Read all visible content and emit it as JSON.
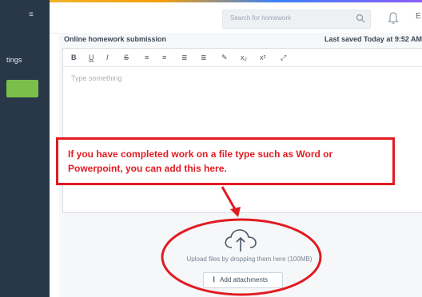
{
  "sidebar": {
    "menu_icon": "hamburger-icon",
    "label": "tings"
  },
  "header": {
    "search_placeholder": "Search for homework",
    "search_icon": "search-icon",
    "bell_icon": "bell-icon",
    "user_initial": "E"
  },
  "editor": {
    "title": "Online homework submission",
    "last_saved": "Last saved Today at 9:52 AM",
    "placeholder": "Type something",
    "toolbar": [
      {
        "name": "bold",
        "label": "B"
      },
      {
        "name": "underline",
        "label": "U"
      },
      {
        "name": "italic",
        "label": "I"
      },
      {
        "name": "strikethrough",
        "label": "S"
      },
      {
        "name": "bullet-list",
        "label": "≡"
      },
      {
        "name": "numbered-list",
        "label": "≡"
      },
      {
        "name": "align-left",
        "label": "≣"
      },
      {
        "name": "align-right",
        "label": "≣"
      },
      {
        "name": "link",
        "label": "✎"
      },
      {
        "name": "subscript",
        "label": "x₂"
      },
      {
        "name": "superscript",
        "label": "x²"
      },
      {
        "name": "fullscreen",
        "label": "⤢"
      }
    ]
  },
  "upload": {
    "icon": "cloud-upload-icon",
    "instruction": "Upload files by dropping them here (100MB)",
    "button_label": "Add attachments",
    "button_icon": "paperclip-icon"
  },
  "annotation": {
    "text": "If you have completed work on a file type such as Word or Powerpoint, you can add this here.",
    "color": "#e11b22"
  }
}
